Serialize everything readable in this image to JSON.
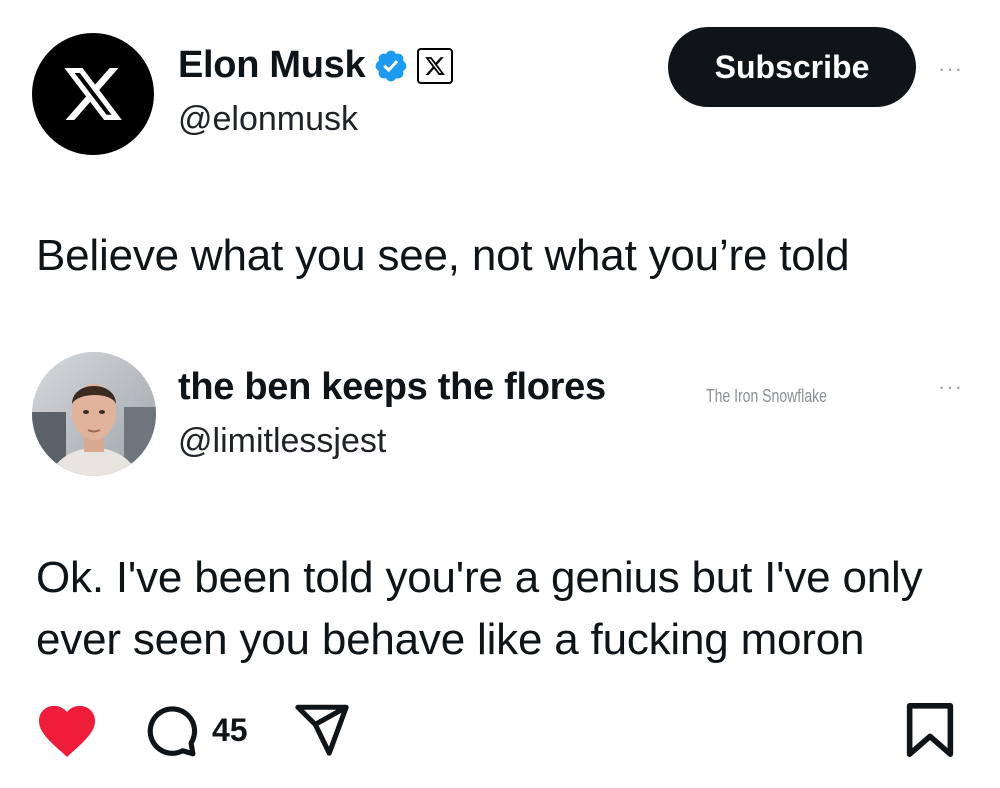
{
  "post": {
    "author": {
      "name": "Elon Musk",
      "handle": "@elonmusk",
      "avatar_icon": "x-logo-icon",
      "verified_icon": "verified-badge-icon",
      "affiliation_icon": "x-badge-icon"
    },
    "subscribe_label": "Subscribe",
    "more_label": "···",
    "text": "Believe what you see, not what you’re told"
  },
  "reply": {
    "author": {
      "name": "the ben keeps the flores",
      "handle": "@limitlessjest",
      "avatar_icon": "profile-photo"
    },
    "watermark": "The Iron Snowflake",
    "more_label": "···",
    "text_line1": "Ok. I've been told you're a genius but I've only",
    "text_line2": "ever seen you behave like a fucking moron"
  },
  "actions": {
    "like_icon": "heart-icon",
    "comment_icon": "comment-bubble-icon",
    "comment_count": "45",
    "share_icon": "send-icon",
    "save_icon": "bookmark-icon"
  },
  "colors": {
    "like": "#ee1d3a",
    "verified": "#1d9bf0",
    "button_bg": "#0f1419"
  }
}
